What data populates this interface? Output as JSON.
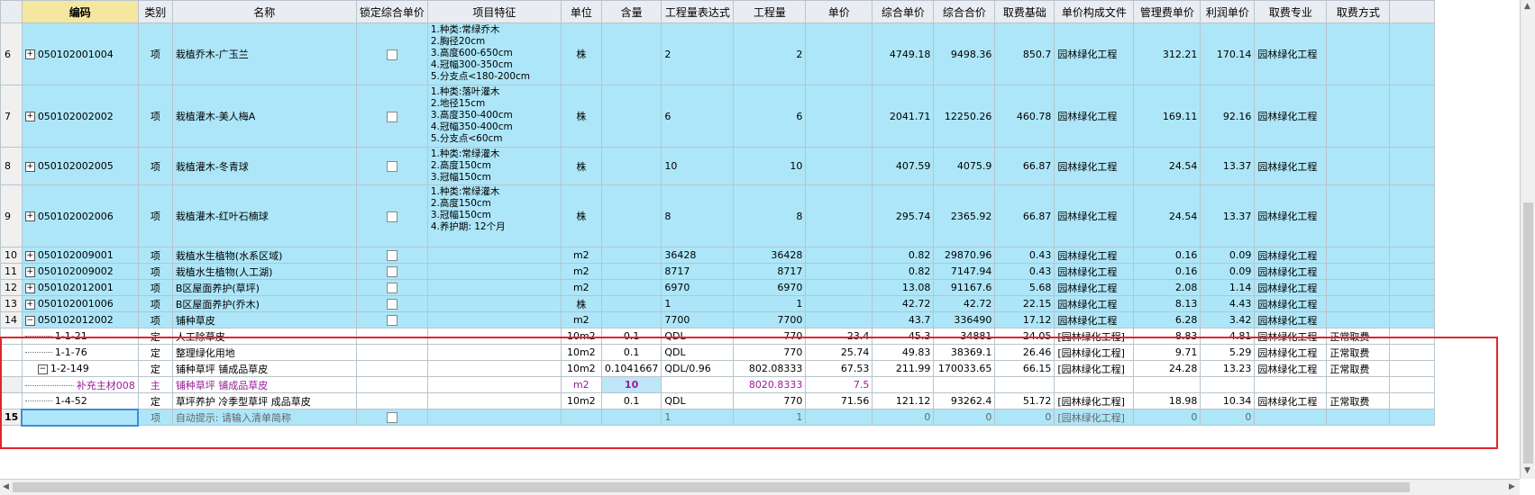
{
  "columns": [
    "",
    "编码",
    "类别",
    "名称",
    "锁定综合单价",
    "项目特征",
    "单位",
    "含量",
    "工程量表达式",
    "工程量",
    "单价",
    "综合单价",
    "综合合价",
    "取费基础",
    "单价构成文件",
    "管理费单价",
    "利润单价",
    "取费专业",
    "取费方式"
  ],
  "rows": [
    {
      "type": "hl",
      "num": "6",
      "toggle": "+",
      "code": "050102001004",
      "cat": "项",
      "name": "栽植乔木-广玉兰",
      "lock": true,
      "feat": "1.种类:常绿乔木\n2.胸径20cm\n3.高度600-650cm\n4.冠幅300-350cm\n5.分支点<180-200cm",
      "unit": "株",
      "content": "",
      "expr": "2",
      "qty": "2",
      "price": "",
      "comp": "4749.18",
      "total": "9498.36",
      "base": "850.7",
      "file": "园林绿化工程",
      "mgmt": "312.21",
      "profit": "170.14",
      "spec": "园林绿化工程",
      "method": ""
    },
    {
      "type": "hl",
      "num": "7",
      "toggle": "+",
      "code": "050102002002",
      "cat": "项",
      "name": "栽植灌木-美人梅A",
      "lock": true,
      "feat": "1.种类:落叶灌木\n2.地径15cm\n3.高度350-400cm\n4.冠幅350-400cm\n5.分支点<60cm",
      "unit": "株",
      "content": "",
      "expr": "6",
      "qty": "6",
      "price": "",
      "comp": "2041.71",
      "total": "12250.26",
      "base": "460.78",
      "file": "园林绿化工程",
      "mgmt": "169.11",
      "profit": "92.16",
      "spec": "园林绿化工程",
      "method": ""
    },
    {
      "type": "hl",
      "num": "8",
      "toggle": "+",
      "code": "050102002005",
      "cat": "项",
      "name": "栽植灌木-冬青球",
      "lock": true,
      "feat": "1.种类:常绿灌木\n2.高度150cm\n3.冠幅150cm",
      "unit": "株",
      "content": "",
      "expr": "10",
      "qty": "10",
      "price": "",
      "comp": "407.59",
      "total": "4075.9",
      "base": "66.87",
      "file": "园林绿化工程",
      "mgmt": "24.54",
      "profit": "13.37",
      "spec": "园林绿化工程",
      "method": ""
    },
    {
      "type": "hl",
      "num": "9",
      "toggle": "+",
      "code": "050102002006",
      "cat": "项",
      "name": "栽植灌木-红叶石楠球",
      "lock": true,
      "feat": "1.种类:常绿灌木\n2.高度150cm\n3.冠幅150cm\n4.养护期: 12个月",
      "unit": "株",
      "content": "",
      "expr": "8",
      "qty": "8",
      "price": "",
      "comp": "295.74",
      "total": "2365.92",
      "base": "66.87",
      "file": "园林绿化工程",
      "mgmt": "24.54",
      "profit": "13.37",
      "spec": "园林绿化工程",
      "method": ""
    },
    {
      "type": "hl",
      "num": "10",
      "toggle": "+",
      "code": "050102009001",
      "cat": "项",
      "name": "栽植水生植物(水系区域)",
      "lock": true,
      "feat": "",
      "unit": "m2",
      "content": "",
      "expr": "36428",
      "qty": "36428",
      "price": "",
      "comp": "0.82",
      "total": "29870.96",
      "base": "0.43",
      "file": "园林绿化工程",
      "mgmt": "0.16",
      "profit": "0.09",
      "spec": "园林绿化工程",
      "method": ""
    },
    {
      "type": "hl",
      "num": "11",
      "toggle": "+",
      "code": "050102009002",
      "cat": "项",
      "name": "栽植水生植物(人工湖)",
      "lock": true,
      "feat": "",
      "unit": "m2",
      "content": "",
      "expr": "8717",
      "qty": "8717",
      "price": "",
      "comp": "0.82",
      "total": "7147.94",
      "base": "0.43",
      "file": "园林绿化工程",
      "mgmt": "0.16",
      "profit": "0.09",
      "spec": "园林绿化工程",
      "method": ""
    },
    {
      "type": "hl",
      "num": "12",
      "toggle": "+",
      "code": "050102012001",
      "cat": "项",
      "name": "B区屋面养护(草坪)",
      "lock": true,
      "feat": "",
      "unit": "m2",
      "content": "",
      "expr": "6970",
      "qty": "6970",
      "price": "",
      "comp": "13.08",
      "total": "91167.6",
      "base": "5.68",
      "file": "园林绿化工程",
      "mgmt": "2.08",
      "profit": "1.14",
      "spec": "园林绿化工程",
      "method": ""
    },
    {
      "type": "hl",
      "num": "13",
      "toggle": "+",
      "code": "050102001006",
      "cat": "项",
      "name": "B区屋面养护(乔木)",
      "lock": true,
      "feat": "",
      "unit": "株",
      "content": "",
      "expr": "1",
      "qty": "1",
      "price": "",
      "comp": "42.72",
      "total": "42.72",
      "base": "22.15",
      "file": "园林绿化工程",
      "mgmt": "8.13",
      "profit": "4.43",
      "spec": "园林绿化工程",
      "method": ""
    },
    {
      "type": "hl",
      "num": "14",
      "toggle": "−",
      "code": "050102012002",
      "cat": "项",
      "name": "铺种草皮",
      "lock": true,
      "feat": "",
      "unit": "m2",
      "content": "",
      "expr": "7700",
      "qty": "7700",
      "price": "",
      "comp": "43.7",
      "total": "336490",
      "base": "17.12",
      "file": "园林绿化工程",
      "mgmt": "6.28",
      "profit": "3.42",
      "spec": "园林绿化工程",
      "method": ""
    },
    {
      "type": "sub",
      "num": "",
      "toggle": "",
      "code": "1-1-21",
      "cat": "定",
      "name": "人工除草皮",
      "lock": false,
      "feat": "",
      "unit": "10m2",
      "content": "0.1",
      "expr": "QDL",
      "qty": "770",
      "price": "23.4",
      "comp": "45.3",
      "total": "34881",
      "base": "24.05",
      "file": "[园林绿化工程]",
      "mgmt": "8.83",
      "profit": "4.81",
      "spec": "园林绿化工程",
      "method": "正常取费"
    },
    {
      "type": "sub",
      "num": "",
      "toggle": "",
      "code": "1-1-76",
      "cat": "定",
      "name": "整理绿化用地",
      "lock": false,
      "feat": "",
      "unit": "10m2",
      "content": "0.1",
      "expr": "QDL",
      "qty": "770",
      "price": "25.74",
      "comp": "49.83",
      "total": "38369.1",
      "base": "26.46",
      "file": "[园林绿化工程]",
      "mgmt": "9.71",
      "profit": "5.29",
      "spec": "园林绿化工程",
      "method": "正常取费"
    },
    {
      "type": "sub",
      "num": "",
      "toggle": "−",
      "code": "1-2-149",
      "cat": "定",
      "name": "铺种草坪 铺成品草皮",
      "lock": false,
      "feat": "",
      "unit": "10m2",
      "content": "0.1041667",
      "expr": "QDL/0.96",
      "qty": "802.08333",
      "price": "67.53",
      "comp": "211.99",
      "total": "170033.65",
      "base": "66.15",
      "file": "[园林绿化工程]",
      "mgmt": "24.28",
      "profit": "13.23",
      "spec": "园林绿化工程",
      "method": "正常取费"
    },
    {
      "type": "mat",
      "num": "",
      "toggle": "",
      "code": "补充主材008",
      "cat": "主",
      "name": "铺种草坪 铺成品草皮",
      "lock": false,
      "feat": "",
      "unit": "m2",
      "content": "10",
      "expr": "",
      "qty": "8020.8333",
      "price": "7.5",
      "comp": "",
      "total": "",
      "base": "",
      "file": "",
      "mgmt": "",
      "profit": "",
      "spec": "",
      "method": ""
    },
    {
      "type": "sub",
      "num": "",
      "toggle": "",
      "code": "1-4-52",
      "cat": "定",
      "name": "草坪养护 冷季型草坪 成品草皮",
      "lock": false,
      "feat": "",
      "unit": "10m2",
      "content": "0.1",
      "expr": "QDL",
      "qty": "770",
      "price": "71.56",
      "comp": "121.12",
      "total": "93262.4",
      "base": "51.72",
      "file": "[园林绿化工程]",
      "mgmt": "18.98",
      "profit": "10.34",
      "spec": "园林绿化工程",
      "method": "正常取费"
    },
    {
      "type": "auto",
      "num": "15",
      "toggle": "",
      "code": "",
      "cat": "项",
      "name": "自动提示: 请输入清单简称",
      "lock": true,
      "feat": "",
      "unit": "",
      "content": "",
      "expr": "1",
      "qty": "1",
      "price": "",
      "comp": "0",
      "total": "0",
      "base": "0",
      "file": "[园林绿化工程]",
      "mgmt": "0",
      "profit": "0",
      "spec": "",
      "method": ""
    }
  ]
}
